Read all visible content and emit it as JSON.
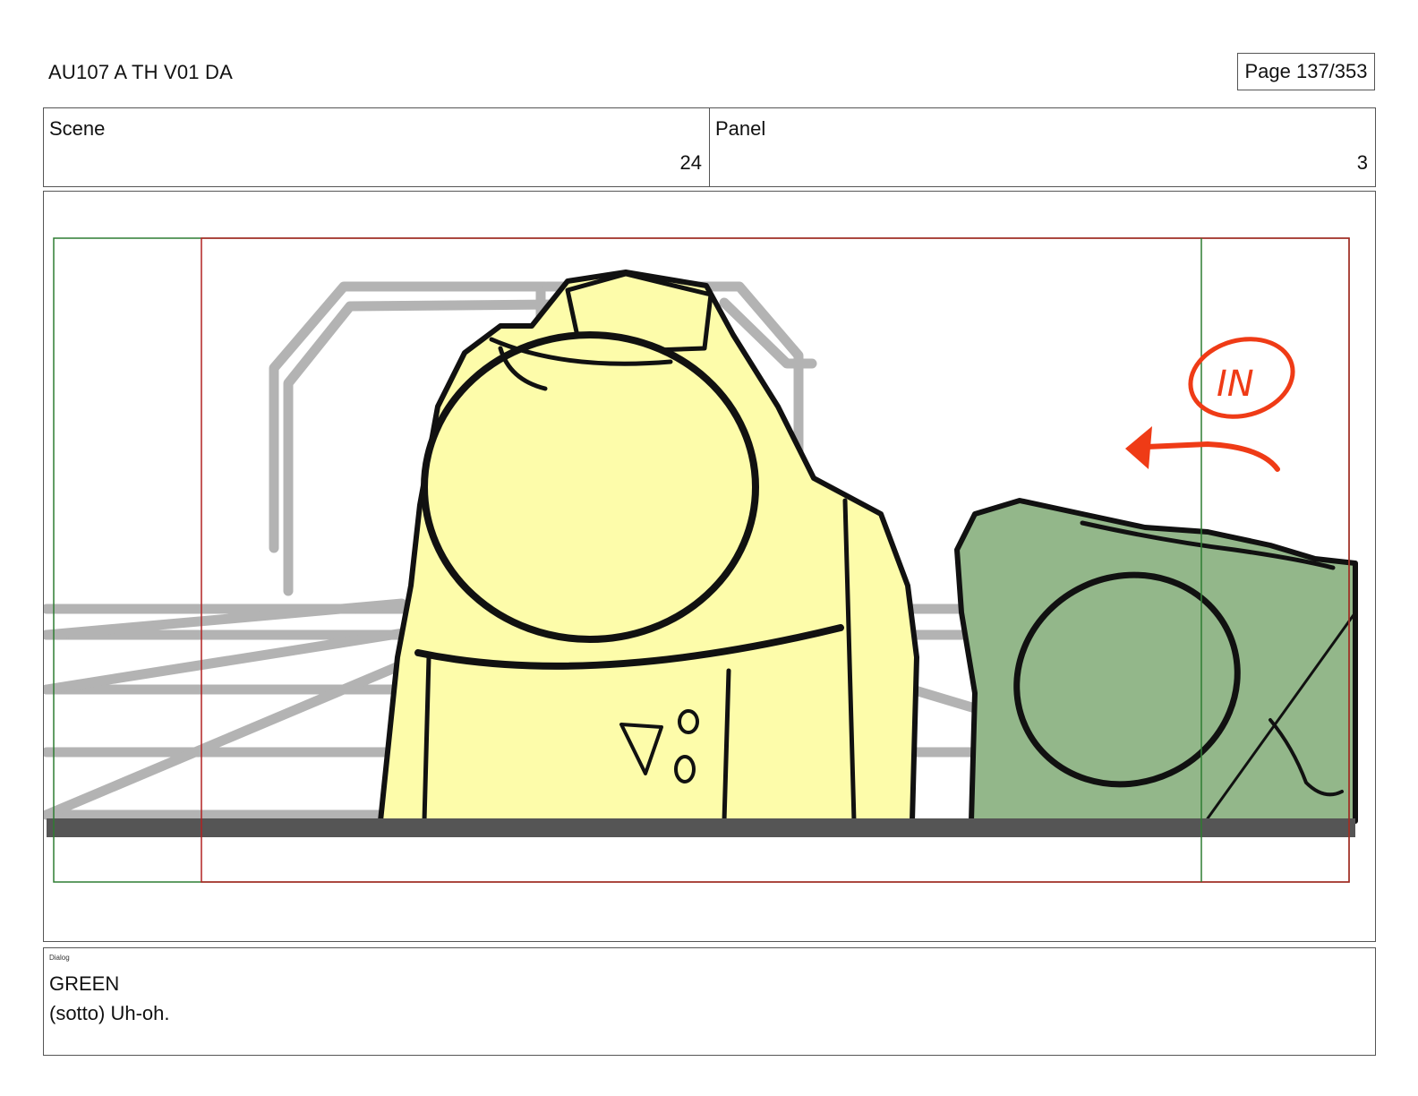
{
  "header": {
    "doc_title": "AU107 A TH V01 DA",
    "page_label": "Page 137/353"
  },
  "scene": {
    "label": "Scene",
    "value": "24"
  },
  "panel": {
    "label": "Panel",
    "value": "3"
  },
  "drawing": {
    "annotation_text": "IN",
    "colors": {
      "yellow_character": "#fdfcaa",
      "green_character": "#93b78a",
      "background_lines": "#b3b3b3",
      "floor": "#555555",
      "safe_frame_red": "#b22222",
      "safe_frame_green": "#2e7d32",
      "arrow_red": "#ef3b16"
    }
  },
  "dialog": {
    "label": "Dialog",
    "speaker": "GREEN",
    "line": "(sotto) Uh-oh."
  }
}
